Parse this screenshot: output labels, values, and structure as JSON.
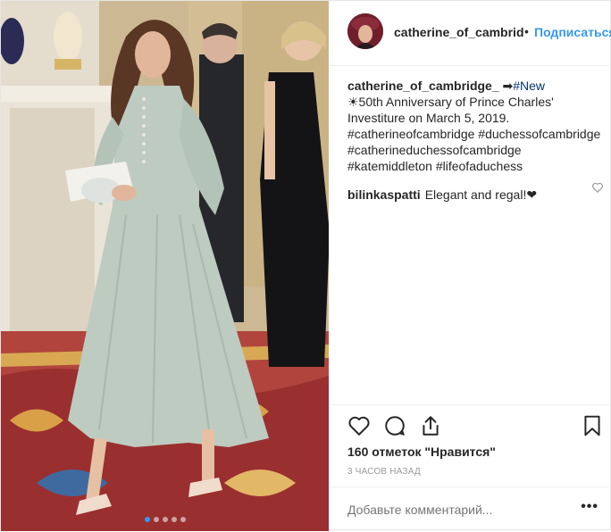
{
  "post": {
    "username": "catherine_of_cambridge_",
    "bullet": "•",
    "follow_label": "Подписаться"
  },
  "caption": {
    "username": "catherine_of_cambridge_",
    "arrow": "➡",
    "lines": [
      "#New",
      "☀50th Anniversary of Prince Charles'",
      "Investiture on March 5, 2019.",
      "#catherineofcambridge #duchessofcambridge",
      "#catherineduchessofcambridge",
      "#katemiddleton #lifeofaduchess"
    ]
  },
  "comment": {
    "username": "bilinkaspatti",
    "text": "Elegant and regal!❤"
  },
  "likes_label": "160 отметок \"Нравится\"",
  "time_label": "3 часов назад",
  "add_comment_placeholder": "Добавьте комментарий...",
  "more_label": "•••",
  "icons": {
    "like": "heart-icon",
    "comment": "comment-icon",
    "share": "share-icon",
    "save": "bookmark-icon",
    "comment_like": "heart-icon"
  },
  "carousel": {
    "count": 5,
    "active_index": 0
  },
  "colors": {
    "link": "#3897f0",
    "hashtag": "#003569",
    "muted": "#999999",
    "text": "#262626"
  }
}
